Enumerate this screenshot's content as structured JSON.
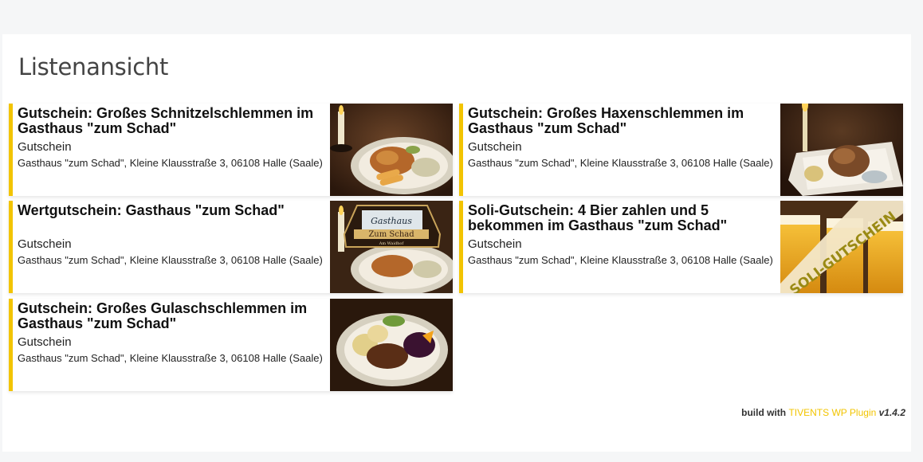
{
  "page": {
    "title": "Listenansicht"
  },
  "cards": [
    {
      "title": "Gutschein: Großes Schnitzelschlemmen im Gasthaus \"zum Schad\"",
      "type": "Gutschein",
      "address": "Gasthaus \"zum Schad\", Kleine Klausstraße 3, 06108 Halle (Saale)",
      "image": "schnitzel-plate-photo"
    },
    {
      "title": "Gutschein: Großes Haxenschlemmen im Gasthaus \"zum Schad\"",
      "type": "Gutschein",
      "address": "Gasthaus \"zum Schad\", Kleine Klausstraße 3, 06108 Halle (Saale)",
      "image": "haxe-plate-photo"
    },
    {
      "title": "Wertgutschein: Gasthaus \"zum Schad\"",
      "type": "Gutschein",
      "address": "Gasthaus \"zum Schad\", Kleine Klausstraße 3, 06108 Halle (Saale)",
      "image": "gasthaus-sign-photo",
      "image_text": {
        "line1": "Gasthaus",
        "line2": "Zum Schad",
        "line3": "Am Waidhof"
      }
    },
    {
      "title": "Soli-Gutschein: 4 Bier zahlen und 5 bekommen im Gasthaus \"zum Schad\"",
      "type": "Gutschein",
      "address": "Gasthaus \"zum Schad\", Kleine Klausstraße 3, 06108 Halle (Saale)",
      "image": "beer-mugs-photo",
      "image_text": {
        "ribbon": "SOLI-GUTSCHEIN"
      }
    },
    {
      "title": "Gutschein: Großes Gulaschschlemmen im Gasthaus \"zum Schad\"",
      "type": "Gutschein",
      "address": "Gasthaus \"zum Schad\", Kleine Klausstraße 3, 06108 Halle (Saale)",
      "image": "gulasch-plate-photo"
    }
  ],
  "footer": {
    "prefix": "build with",
    "plugin": "TIVENTS WP Plugin",
    "version": "v1.4.2"
  },
  "colors": {
    "accent": "#f2c400",
    "background": "#f5f6f7",
    "panel": "#ffffff"
  }
}
